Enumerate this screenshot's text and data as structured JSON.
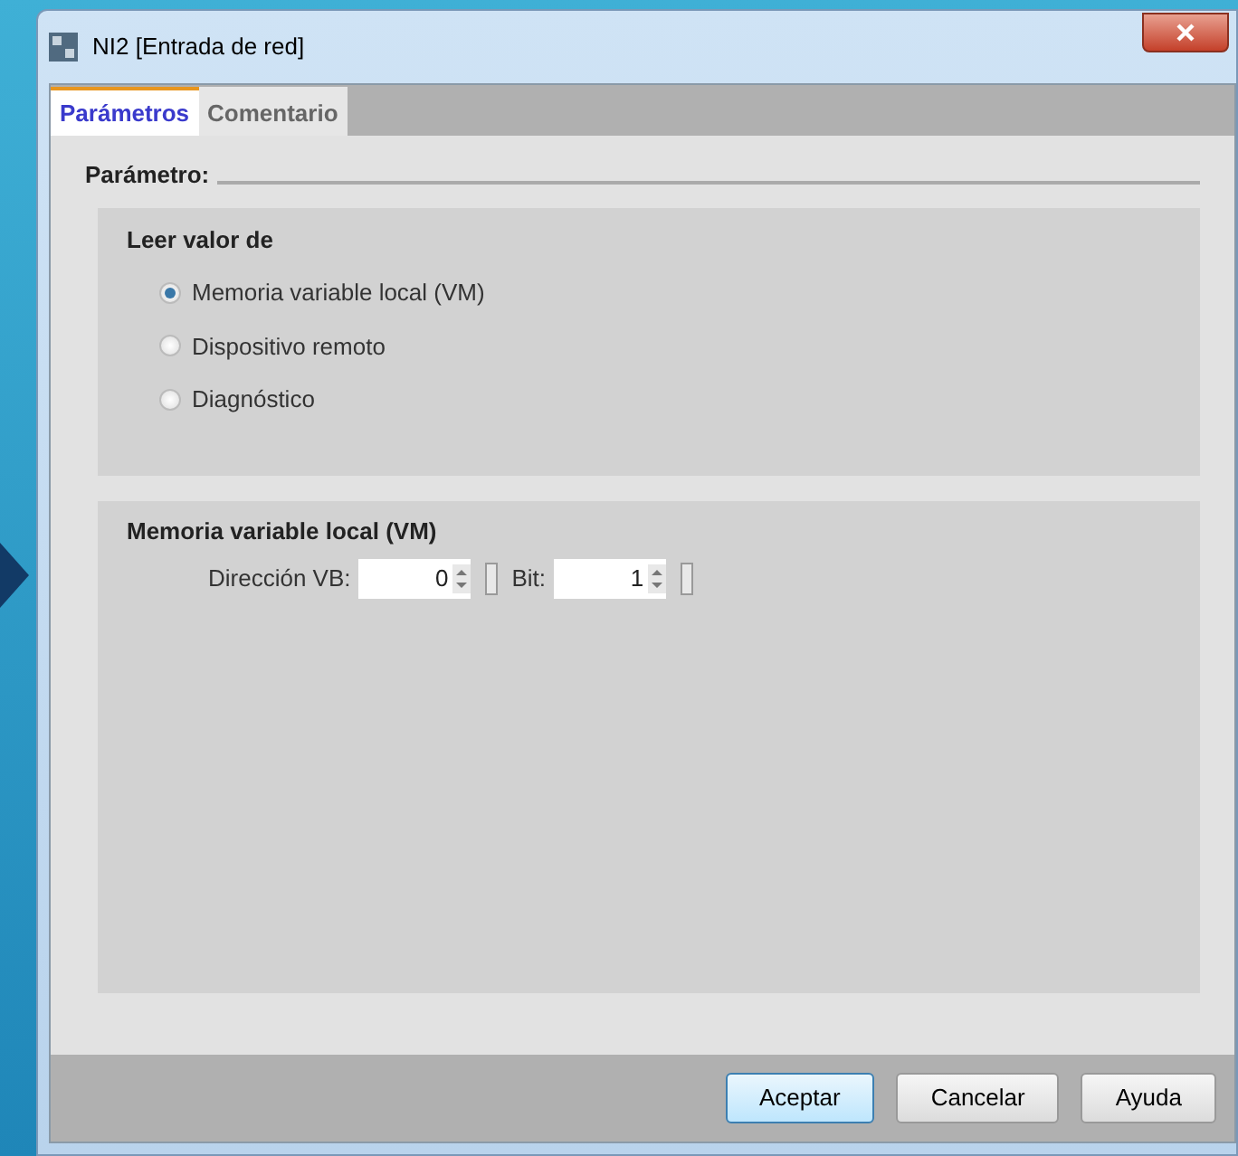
{
  "window": {
    "title": "NI2 [Entrada de red]"
  },
  "tabs": [
    {
      "label": "Parámetros",
      "selected": true
    },
    {
      "label": "Comentario",
      "selected": false
    }
  ],
  "section_title": "Parámetro:",
  "read_group": {
    "title": "Leer valor de",
    "options": [
      {
        "label": "Memoria variable local (VM)",
        "selected": true
      },
      {
        "label": "Dispositivo remoto",
        "selected": false
      },
      {
        "label": "Diagnóstico",
        "selected": false
      }
    ]
  },
  "vm_group": {
    "title": "Memoria variable local (VM)",
    "fields": [
      {
        "label": "Dirección VB:",
        "value": "0"
      },
      {
        "label": "Bit:",
        "value": "1"
      }
    ]
  },
  "buttons": [
    {
      "label": "Aceptar",
      "default": true
    },
    {
      "label": "Cancelar",
      "default": false
    },
    {
      "label": "Ayuda",
      "default": false
    }
  ]
}
